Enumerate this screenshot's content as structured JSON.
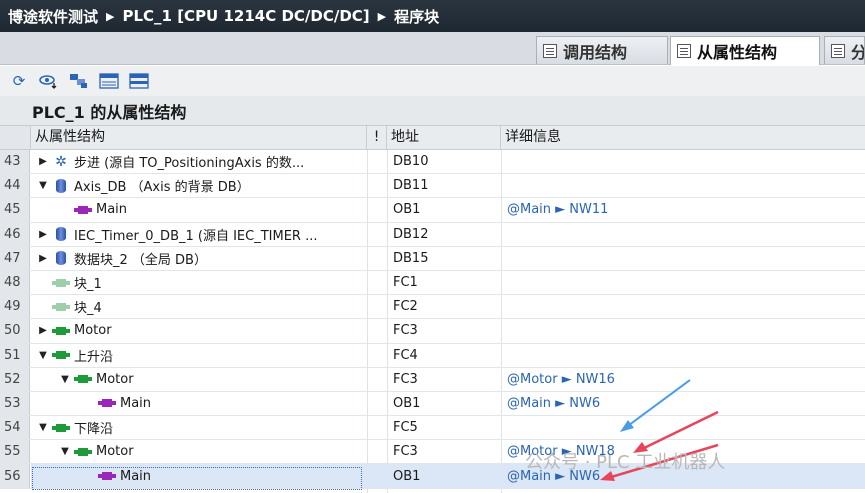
{
  "breadcrumb": {
    "project": "博途软件测试",
    "device": "PLC_1 [CPU 1214C DC/DC/DC]",
    "folder": "程序块"
  },
  "tabs": [
    {
      "label": "调用结构"
    },
    {
      "label": "从属性结构"
    },
    {
      "label": "分"
    }
  ],
  "toolbar_icons": [
    "refresh-icon",
    "show-icon",
    "group-icon",
    "expand-icon",
    "collapse-icon"
  ],
  "section_title": "PLC_1 的从属性结构",
  "columns": {
    "structure": "从属性结构",
    "flag": "!",
    "address": "地址",
    "details": "详细信息"
  },
  "rows": [
    {
      "num": "43",
      "name": "步进 (源自 TO_PositioningAxis 的数...",
      "addr": "DB10",
      "detail": "",
      "icon": "tech",
      "expander": "▶"
    },
    {
      "num": "44",
      "name": "Axis_DB （Axis 的背景 DB）",
      "addr": "DB11",
      "detail": "",
      "icon": "db",
      "expander": "▼"
    },
    {
      "num": "45",
      "name": "Main",
      "addr": "OB1",
      "detail": "@Main ► NW11",
      "icon": "ob",
      "expander": ""
    },
    {
      "num": "46",
      "name": "IEC_Timer_0_DB_1 (源自 IEC_TIMER ...",
      "addr": "DB12",
      "detail": "",
      "icon": "db",
      "expander": "▶"
    },
    {
      "num": "47",
      "name": "数据块_2 （全局 DB）",
      "addr": "DB15",
      "detail": "",
      "icon": "db",
      "expander": "▶"
    },
    {
      "num": "48",
      "name": "块_1",
      "addr": "FC1",
      "detail": "",
      "icon": "fc-grey",
      "expander": ""
    },
    {
      "num": "49",
      "name": "块_4",
      "addr": "FC2",
      "detail": "",
      "icon": "fc-grey",
      "expander": ""
    },
    {
      "num": "50",
      "name": "Motor",
      "addr": "FC3",
      "detail": "",
      "icon": "fc",
      "expander": "▶"
    },
    {
      "num": "51",
      "name": "上升沿",
      "addr": "FC4",
      "detail": "",
      "icon": "fc",
      "expander": "▼"
    },
    {
      "num": "52",
      "name": "Motor",
      "addr": "FC3",
      "detail": "@Motor ► NW16",
      "icon": "fc",
      "expander": "▼"
    },
    {
      "num": "53",
      "name": "Main",
      "addr": "OB1",
      "detail": "@Main ► NW6",
      "icon": "ob",
      "expander": ""
    },
    {
      "num": "54",
      "name": "下降沿",
      "addr": "FC5",
      "detail": "",
      "icon": "fc",
      "expander": "▼"
    },
    {
      "num": "55",
      "name": "Motor",
      "addr": "FC3",
      "detail": "@Motor ► NW18",
      "icon": "fc",
      "expander": "▼"
    },
    {
      "num": "56",
      "name": "Main",
      "addr": "OB1",
      "detail": "@Main ► NW6",
      "icon": "ob",
      "expander": ""
    }
  ],
  "selected_row": "56",
  "watermark": "公众号 · PLC 工业机器人",
  "colors": {
    "titlebar": "#1f2831",
    "link": "#2a64b5",
    "fc_icon": "#1f9a3a",
    "ob_icon": "#9a27b8",
    "db_icon": "#2c4fa8",
    "selection": "#dbe6f6",
    "arrow": "#e8455a"
  }
}
